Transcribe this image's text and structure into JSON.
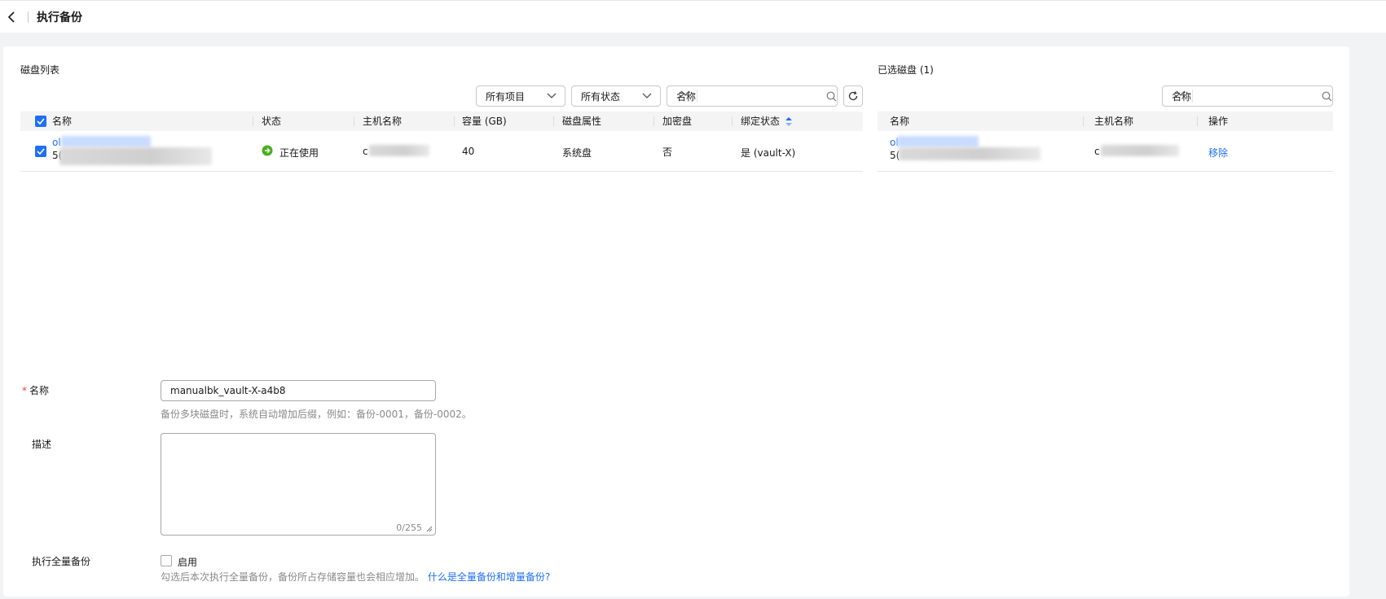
{
  "header": {
    "back_icon": "chevron-left-icon",
    "title": "执行备份"
  },
  "disk_list": {
    "title": "磁盘列表",
    "filters": {
      "project": "所有项目",
      "status": "所有状态",
      "search_field": "名称",
      "search_placeholder": ""
    },
    "columns": [
      "名称",
      "状态",
      "主机名称",
      "容量 (GB)",
      "磁盘属性",
      "加密盘",
      "绑定状态"
    ],
    "rows": [
      {
        "name_line1": "ol",
        "name_line2": "5(",
        "status": "正在使用",
        "host": "c",
        "capacity": "40",
        "attribute": "系统盘",
        "encrypted": "否",
        "binding": "是 (vault-X)"
      }
    ]
  },
  "selected_disks": {
    "title": "已选磁盘 (1)",
    "search_field": "名称",
    "columns": [
      "名称",
      "主机名称",
      "操作"
    ],
    "rows": [
      {
        "name_line1": "ol",
        "name_line2": "5(",
        "host": "c",
        "action": "移除"
      }
    ]
  },
  "form": {
    "name_label": "名称",
    "name_value": "manualbk_vault-X-a4b8",
    "name_hint": "备份多块磁盘时，系统自动增加后缀，例如：备份-0001，备份-0002。",
    "desc_label": "描述",
    "desc_counter": "0/255",
    "full_label": "执行全量备份",
    "full_option": "启用",
    "full_hint": "勾选后本次执行全量备份，备份所占存储容量也会相应增加。",
    "full_link": "什么是全量备份和增量备份?"
  },
  "colors": {
    "primary": "#1f6ff5",
    "status_ok": "#4caf1f",
    "required": "#e84a4a"
  }
}
